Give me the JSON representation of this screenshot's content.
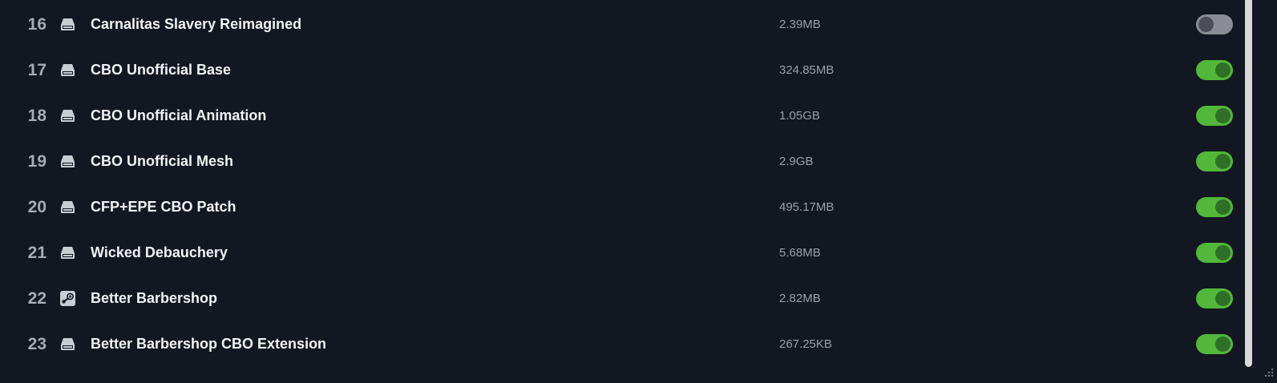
{
  "mods": [
    {
      "index": "16",
      "name": "Carnalitas Slavery Reimagined",
      "size": "2.39MB",
      "source_icon": "drive-icon",
      "enabled": false
    },
    {
      "index": "17",
      "name": "CBO Unofficial Base",
      "size": "324.85MB",
      "source_icon": "drive-icon",
      "enabled": true
    },
    {
      "index": "18",
      "name": "CBO Unofficial Animation",
      "size": "1.05GB",
      "source_icon": "drive-icon",
      "enabled": true
    },
    {
      "index": "19",
      "name": "CBO Unofficial Mesh",
      "size": "2.9GB",
      "source_icon": "drive-icon",
      "enabled": true
    },
    {
      "index": "20",
      "name": "CFP+EPE CBO Patch",
      "size": "495.17MB",
      "source_icon": "drive-icon",
      "enabled": true
    },
    {
      "index": "21",
      "name": "Wicked Debauchery",
      "size": "5.68MB",
      "source_icon": "drive-icon",
      "enabled": true
    },
    {
      "index": "22",
      "name": "Better Barbershop",
      "size": "2.82MB",
      "source_icon": "steam-icon",
      "enabled": true
    },
    {
      "index": "23",
      "name": "Better Barbershop CBO Extension",
      "size": "267.25KB",
      "source_icon": "drive-icon",
      "enabled": true
    }
  ],
  "colors": {
    "background": "#131722",
    "toggle_on": "#51b83a",
    "toggle_off": "#8a8d93",
    "text_primary": "#f2f3f5",
    "text_secondary": "#9aa0ab"
  }
}
